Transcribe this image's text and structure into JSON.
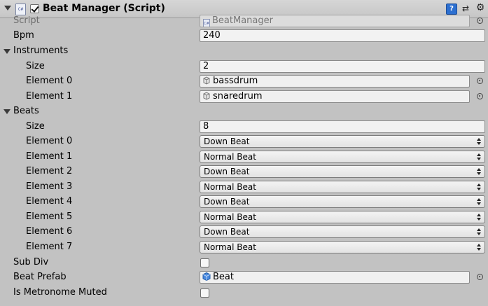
{
  "header": {
    "title": "Beat Manager (Script)",
    "enabled": true,
    "icons": [
      "script-icon",
      "help-icon",
      "preset-icon",
      "gear-icon"
    ]
  },
  "fields": {
    "script": {
      "label": "Script",
      "value": "BeatManager"
    },
    "bpm": {
      "label": "Bpm",
      "value": "240"
    },
    "instruments": {
      "label": "Instruments",
      "size_label": "Size",
      "size": "2",
      "elements": [
        {
          "label": "Element 0",
          "value": "bassdrum"
        },
        {
          "label": "Element 1",
          "value": "snaredrum"
        }
      ]
    },
    "beats": {
      "label": "Beats",
      "size_label": "Size",
      "size": "8",
      "elements": [
        {
          "label": "Element 0",
          "value": "Down Beat"
        },
        {
          "label": "Element 1",
          "value": "Normal Beat"
        },
        {
          "label": "Element 2",
          "value": "Down Beat"
        },
        {
          "label": "Element 3",
          "value": "Normal Beat"
        },
        {
          "label": "Element 4",
          "value": "Down Beat"
        },
        {
          "label": "Element 5",
          "value": "Normal Beat"
        },
        {
          "label": "Element 6",
          "value": "Down Beat"
        },
        {
          "label": "Element 7",
          "value": "Normal Beat"
        }
      ]
    },
    "sub_div": {
      "label": "Sub Div",
      "checked": false
    },
    "beat_prefab": {
      "label": "Beat Prefab",
      "value": "Beat"
    },
    "is_metronome_muted": {
      "label": "Is Metronome Muted",
      "checked": false
    }
  },
  "colors": {
    "background": "#c2c2c2",
    "field": "#f2f2f2",
    "help_icon": "#2c6fd0",
    "prefab_icon": "#3f7fd6"
  }
}
